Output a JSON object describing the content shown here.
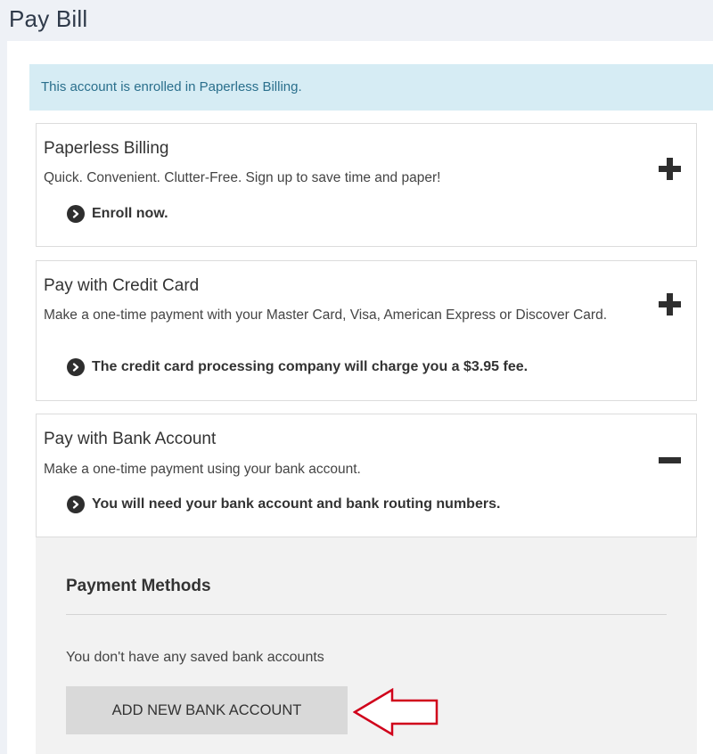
{
  "page": {
    "title": "Pay Bill"
  },
  "alert": {
    "text": "This account is enrolled in Paperless Billing."
  },
  "cards": [
    {
      "title": "Paperless Billing",
      "description": "Quick. Convenient. Clutter-Free. Sign up to save time and paper!",
      "note": "Enroll now.",
      "toggle": "plus-icon"
    },
    {
      "title": "Pay with Credit Card",
      "description": "Make a one-time payment with your Master Card, Visa, American Express or Discover Card.",
      "note": "The credit card processing company will charge you a $3.95 fee.",
      "toggle": "plus-icon"
    },
    {
      "title": "Pay with Bank Account",
      "description": "Make a one-time payment using your bank account.",
      "note": "You will need your bank account and bank routing numbers.",
      "toggle": "minus-icon"
    }
  ],
  "payment_methods": {
    "title": "Payment Methods",
    "empty_text": "You don't have any saved bank accounts",
    "add_button_label": "ADD NEW BANK ACCOUNT"
  },
  "colors": {
    "alert_bg": "#d6ecf4",
    "alert_text": "#2a6f8c",
    "annotation_arrow": "#d0021b"
  }
}
